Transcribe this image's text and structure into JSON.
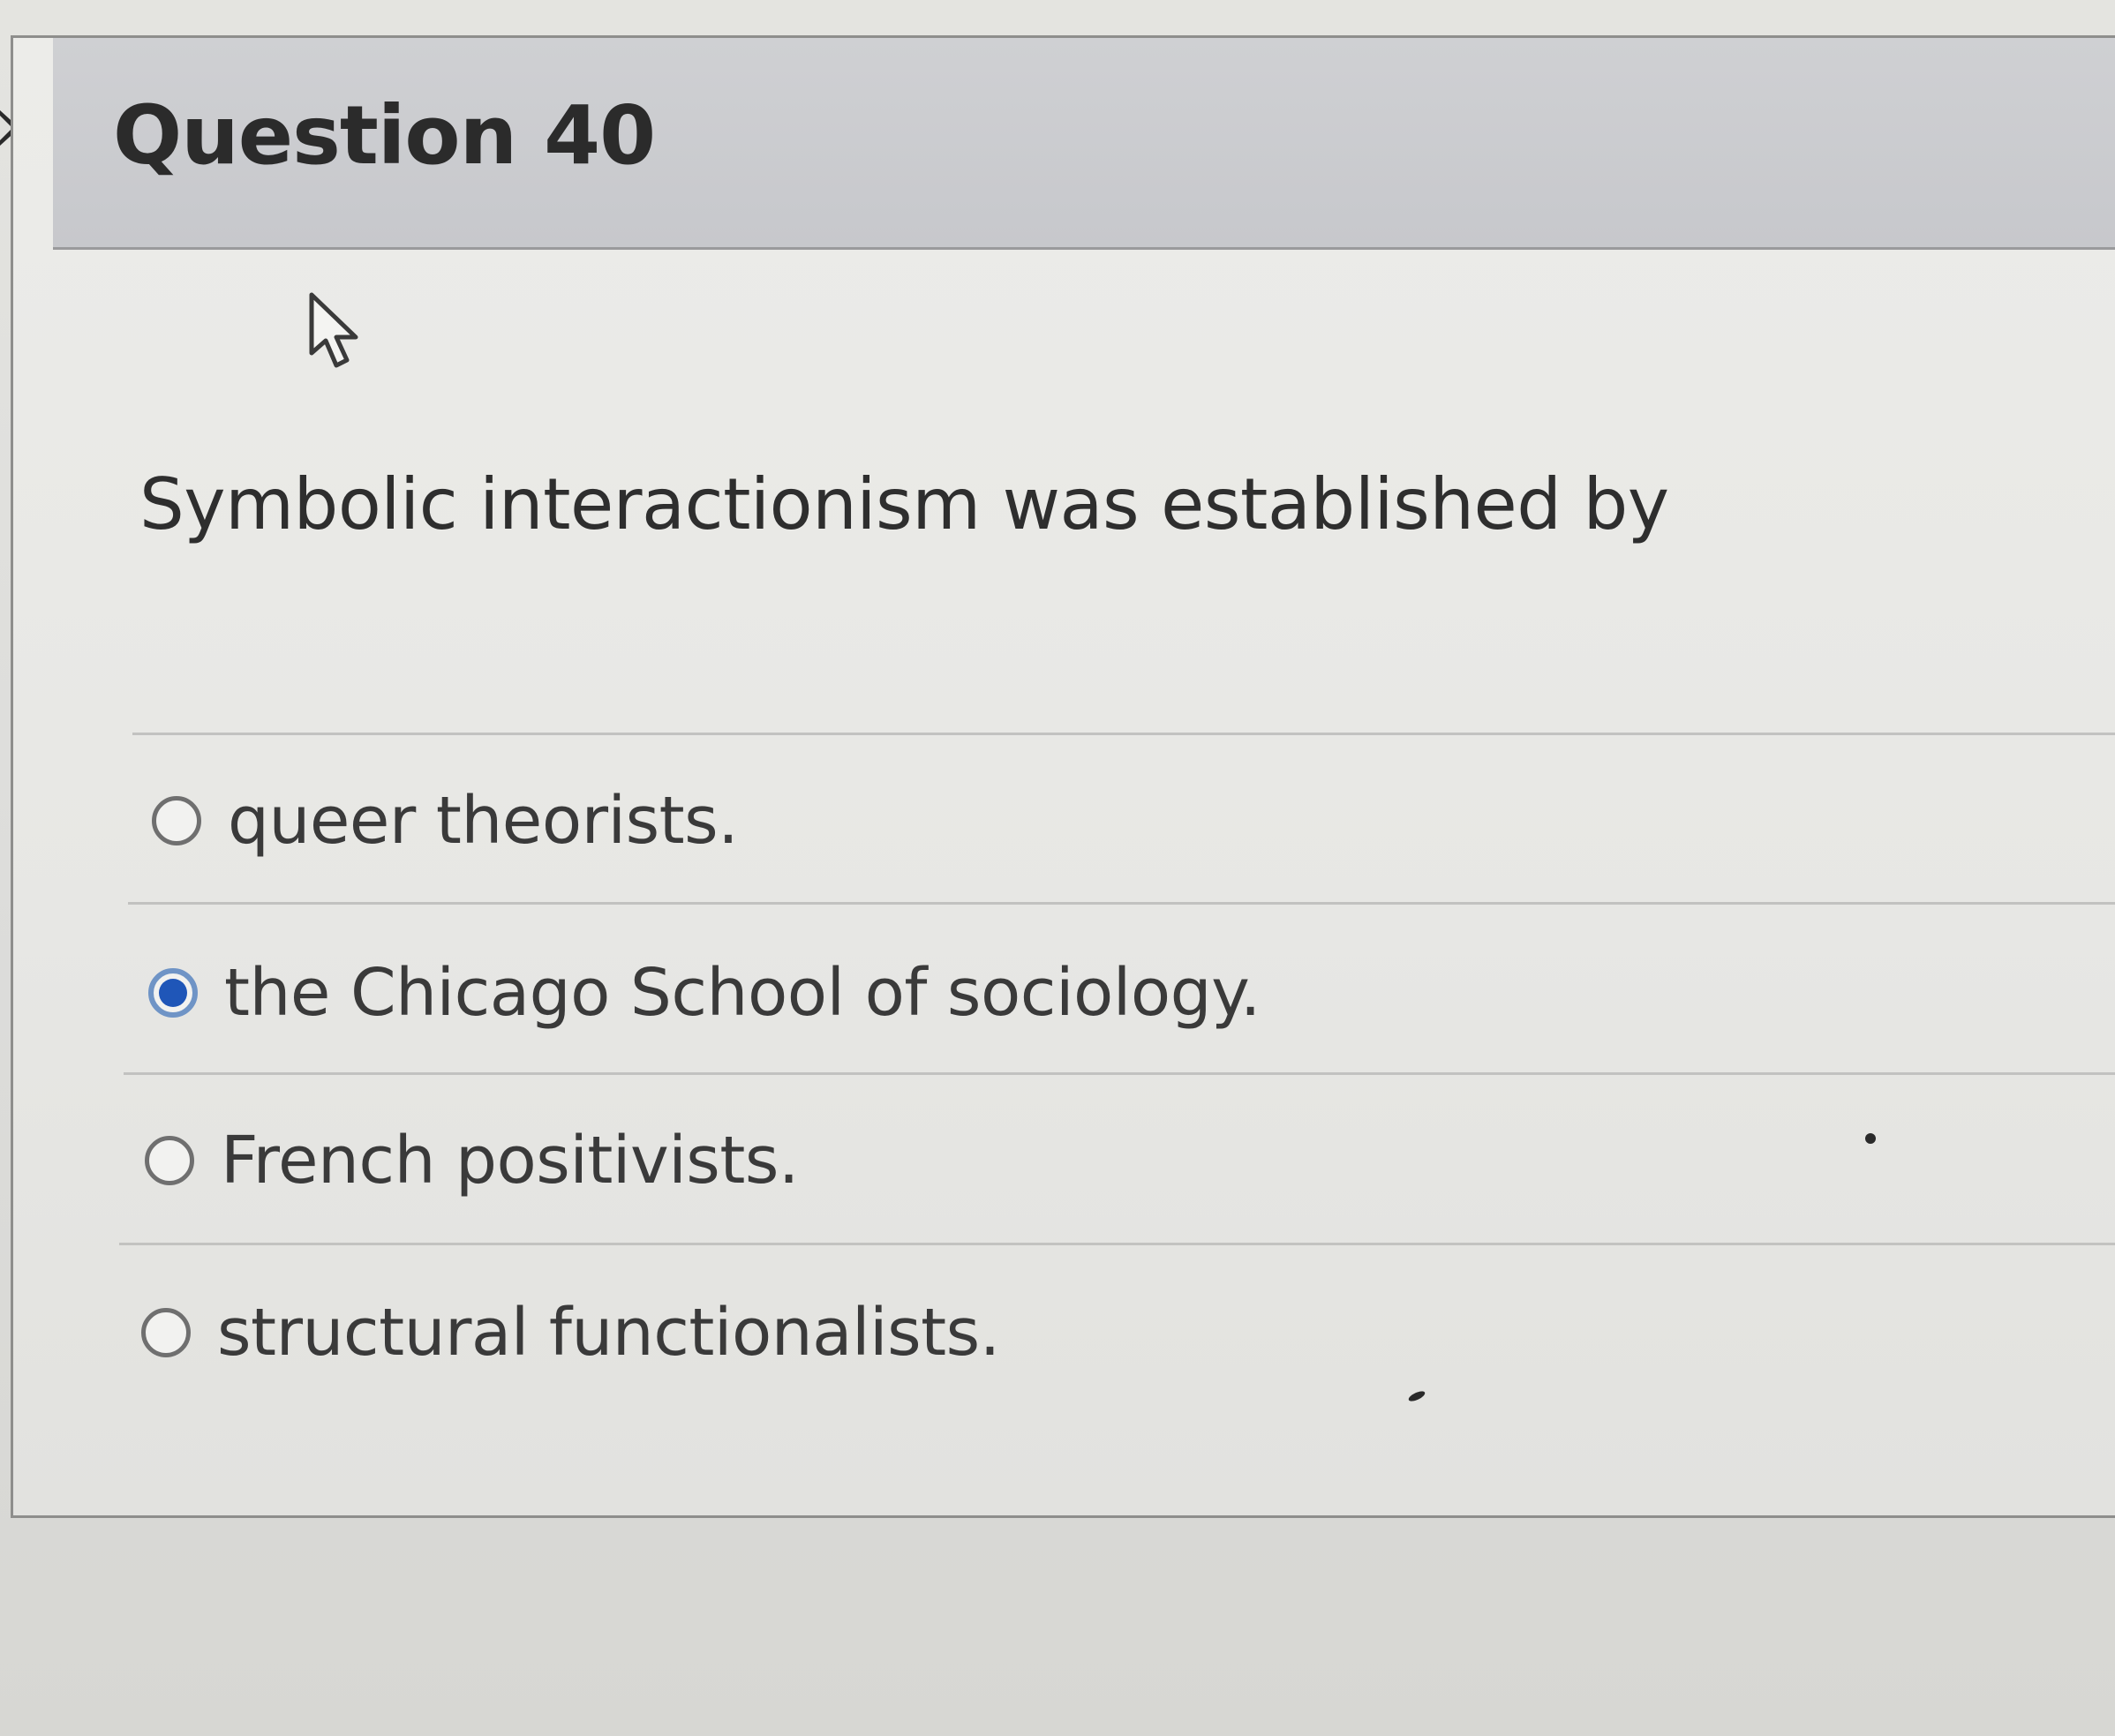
{
  "question": {
    "title": "Question 40",
    "prompt": "Symbolic interactionism was established by"
  },
  "answers": [
    {
      "label": "queer theorists.",
      "selected": false
    },
    {
      "label": "the Chicago School of sociology.",
      "selected": true
    },
    {
      "label": "French positivists.",
      "selected": false
    },
    {
      "label": "structural functionalists.",
      "selected": false
    }
  ],
  "icons": {
    "cursor": "mouse-pointer-icon",
    "nav": "chevron-right-icon"
  },
  "colors": {
    "header_bg": "#c9cacd",
    "selected_radio": "#1f56b8",
    "text": "#2e2e2e"
  }
}
